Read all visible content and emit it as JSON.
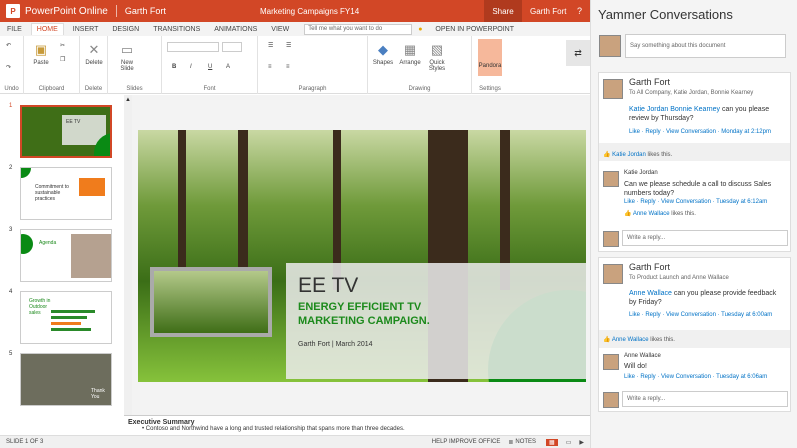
{
  "titlebar": {
    "app": "PowerPoint Online",
    "user_owner": "Garth Fort",
    "doc": "Marketing Campaigns FY14",
    "share": "Share",
    "user": "Garth Fort",
    "help": "?",
    "logo": "P"
  },
  "menu": {
    "file": "FILE",
    "home": "HOME",
    "insert": "INSERT",
    "design": "DESIGN",
    "transitions": "TRANSITIONS",
    "animations": "ANIMATIONS",
    "view": "VIEW",
    "tell": "Tell me what you want to do",
    "open": "OPEN IN POWERPOINT"
  },
  "ribbon": {
    "undo": "Undo",
    "clipboard": "Clipboard",
    "paste": "Paste",
    "delete_grp": "Delete",
    "delete": "Delete",
    "slides": "Slides",
    "new_slide": "New Slide",
    "font": "Font",
    "paragraph": "Paragraph",
    "drawing": "Drawing",
    "shapes": "Shapes",
    "arrange": "Arrange",
    "quick": "Quick Styles",
    "settings": "Settings",
    "pandora": "Pandora"
  },
  "thumbs": [
    {
      "n": "1",
      "t": "EE TV"
    },
    {
      "n": "2",
      "t": "Commitment to sustainable practices"
    },
    {
      "n": "3",
      "t": "Agenda"
    },
    {
      "n": "4",
      "t": "Growth in Outdoor sales"
    },
    {
      "n": "5",
      "t": "Thank You"
    }
  ],
  "slide": {
    "title": "EE TV",
    "subtitle1": "ENERGY EFFICIENT TV",
    "subtitle2": "MARKETING CAMPAIGN.",
    "author": "Garth Fort | March 2014"
  },
  "notes": {
    "heading": "Executive Summary",
    "line1": "Contoso and Northwind have a long and trusted relationship that spans more than three decades."
  },
  "status": {
    "slide": "SLIDE 1 OF 3",
    "help": "HELP IMPROVE OFFICE",
    "notes": "NOTES"
  },
  "yammer": {
    "title": "Yammer Conversations",
    "say": "Say something about this document",
    "c1": {
      "author": "Garth Fort",
      "to": "To All Company, Katie Jordan, Bonnie Kearney",
      "mention": "Katie Jordan Bonnie Kearney",
      "text1": " can you please",
      "text2": "review by Thursday?",
      "actions": "Like · Reply · View Conversation · Monday at 2:12pm",
      "likes_name": "Katie Jordan",
      "likes_rest": " likes this.",
      "r_author": "Katie Jordan",
      "r_text1": "Can we please schedule a call to discuss Sales",
      "r_text2": "numbers today?",
      "r_actions": "Like · Reply · View Conversation · Tuesday at 6:12am",
      "r_likes_name": "Anne Wallace",
      "r_likes_rest": " likes this.",
      "reply": "Write a reply..."
    },
    "c2": {
      "author": "Garth Fort",
      "to": "To Product Launch and Anne Wallace",
      "mention": "Anne Wallace",
      "text1": " can you please provide feedback",
      "text2": "by Friday?",
      "actions": "Like · Reply · View Conversation · Tuesday at 6:00am",
      "likes_name": "Anne Wallace",
      "likes_rest": " likes this.",
      "r_author": "Anne Wallace",
      "r_text": "Will do!",
      "r_actions": "Like · Reply · View Conversation · Tuesday at 6:06am",
      "reply": "Write a reply..."
    }
  }
}
